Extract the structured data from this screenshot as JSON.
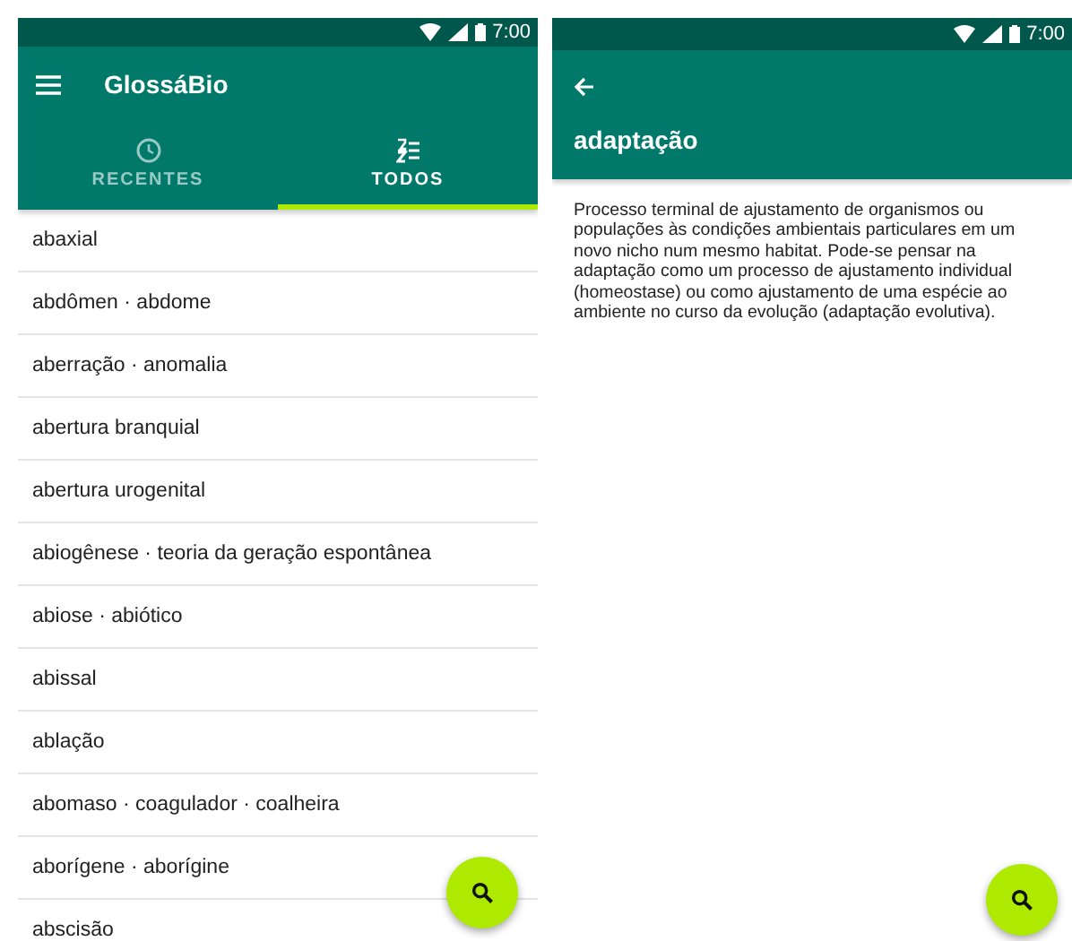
{
  "screens": [
    {
      "kind": "list",
      "status_bar": {
        "time": "7:00"
      },
      "toolbar": {
        "title": "GlossáBio"
      },
      "tabs": [
        {
          "label": "RECENTES",
          "selected": false
        },
        {
          "label": "TODOS",
          "selected": true
        }
      ],
      "items": [
        "abaxial",
        "abdômen · abdome",
        "aberração · anomalia",
        "abertura branquial",
        "abertura urogenital",
        "abiogênese · teoria da geração espontânea",
        "abiose · abiótico",
        "abissal",
        "ablação",
        "abomaso · coagulador · coalheira",
        "aborígene · aborígine",
        "abscisão"
      ]
    },
    {
      "kind": "detail",
      "status_bar": {
        "time": "7:00"
      },
      "toolbar": {
        "title": "adaptação"
      },
      "definition": "Processo terminal de ajustamento de organismos ou populações às condições ambientais particulares em um novo nicho num mesmo habitat. Pode-se pensar na adaptação como um processo de ajustamento individual (homeostase) ou como ajustamento de uma espécie ao ambiente no curso da evolução (adaptação evolutiva)."
    }
  ]
}
